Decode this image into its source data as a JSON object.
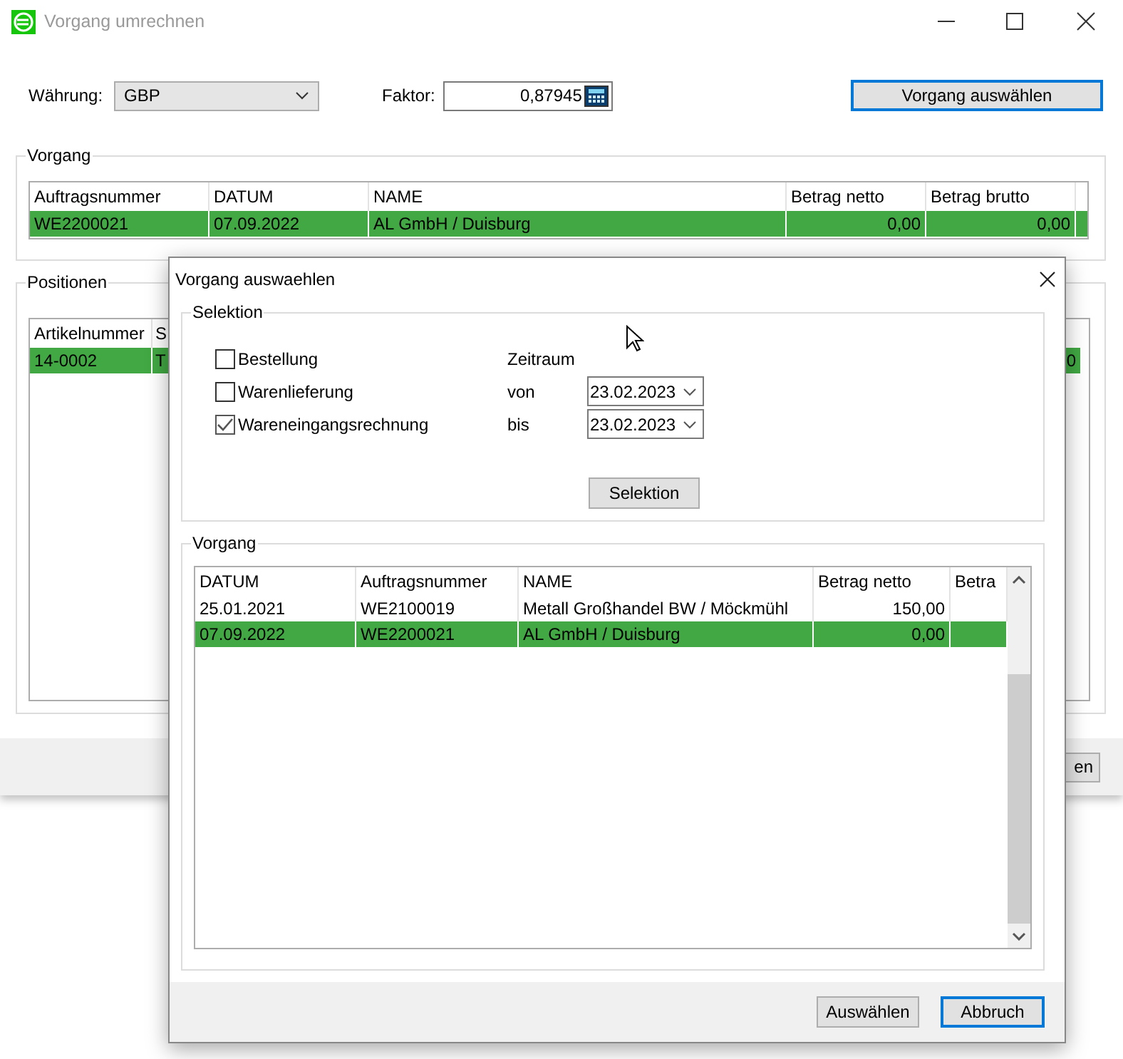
{
  "window": {
    "title": "Vorgang umrechnen"
  },
  "currency": {
    "label": "Währung:",
    "value": "GBP"
  },
  "factor": {
    "label": "Faktor:",
    "value": "0,87945"
  },
  "select_button": {
    "label": "Vorgang auswählen",
    "focused": true
  },
  "vorgang": {
    "title": "Vorgang",
    "columns": [
      "Auftragsnummer",
      "DATUM",
      "NAME",
      "Betrag netto",
      "Betrag brutto"
    ],
    "rows": [
      {
        "cells": [
          "WE2200021",
          "07.09.2022",
          "AL GmbH / Duisburg",
          "0,00",
          "0,00"
        ],
        "selected": true
      }
    ]
  },
  "positionen": {
    "title": "Positionen",
    "columns": [
      "Artikelnummer",
      "S"
    ],
    "rows": [
      {
        "cells": [
          "14-0002",
          "T",
          "0"
        ],
        "selected": true
      }
    ]
  },
  "footer_button": {
    "label": "en"
  },
  "dialog": {
    "title": "Vorgang auswaehlen",
    "selektion": {
      "title": "Selektion",
      "options": [
        {
          "label": "Bestellung",
          "checked": false
        },
        {
          "label": "Warenlieferung",
          "checked": false
        },
        {
          "label": "Wareneingangsrechnung",
          "checked": true
        }
      ],
      "zeitraum": "Zeitraum",
      "von_label": "von",
      "von": "23.02.2023",
      "bis_label": "bis",
      "bis": "23.02.2023",
      "button": "Selektion"
    },
    "vorgang": {
      "title": "Vorgang",
      "columns": [
        "DATUM",
        "Auftragsnummer",
        "NAME",
        "Betrag netto",
        "Betra"
      ],
      "rows": [
        {
          "cells": [
            "25.01.2021",
            "WE2100019",
            "Metall Großhandel BW / Möckmühl",
            "150,00",
            ""
          ],
          "selected": false
        },
        {
          "cells": [
            "07.09.2022",
            "WE2200021",
            "AL GmbH / Duisburg",
            "0,00",
            ""
          ],
          "selected": true
        }
      ]
    },
    "buttons": [
      {
        "label": "Auswählen",
        "focused": false
      },
      {
        "label": "Abbruch",
        "focused": true
      }
    ]
  }
}
